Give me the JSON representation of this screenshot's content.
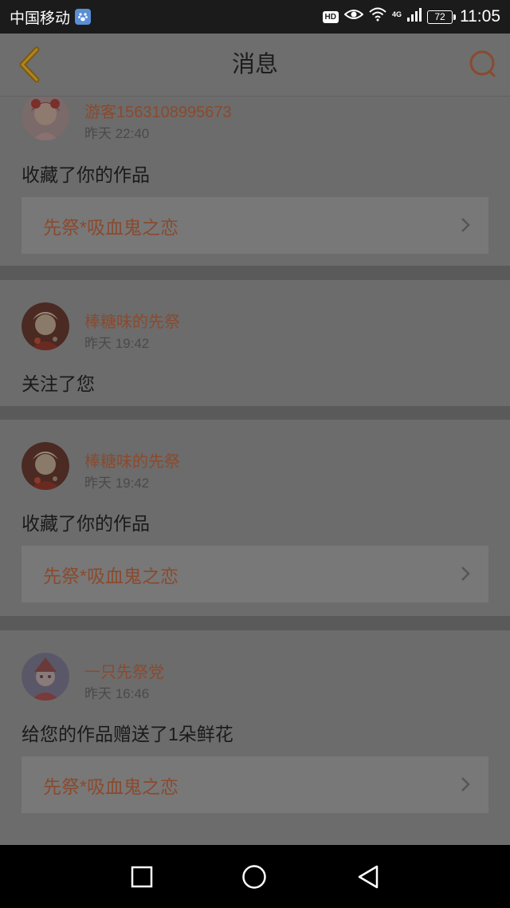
{
  "status_bar": {
    "carrier": "中国移动",
    "hd": "HD",
    "network": "4G",
    "battery": "72",
    "time": "11:05"
  },
  "header": {
    "title": "消息"
  },
  "colors": {
    "accent": "#e67e3a",
    "link": "#8a4a2e",
    "header_bg": "#6e6e6e"
  },
  "messages": [
    {
      "user": "游客1563108995673",
      "time": "昨天 22:40",
      "action": "收藏了你的作品",
      "work": "先祭*吸血鬼之恋"
    },
    {
      "user": "棒糖味的先祭",
      "time": "昨天 19:42",
      "action": "关注了您"
    },
    {
      "user": "棒糖味的先祭",
      "time": "昨天 19:42",
      "action": "收藏了你的作品",
      "work": "先祭*吸血鬼之恋"
    },
    {
      "user": "一只先祭党",
      "time": "昨天 16:46",
      "action": "给您的作品赠送了1朵鲜花",
      "work": "先祭*吸血鬼之恋"
    }
  ],
  "icons": {
    "back": "chevron-left-icon",
    "search": "search-icon",
    "work_arrow": "chevron-right-icon",
    "nav_recent": "square-icon",
    "nav_home": "circle-icon",
    "nav_back": "triangle-back-icon"
  }
}
